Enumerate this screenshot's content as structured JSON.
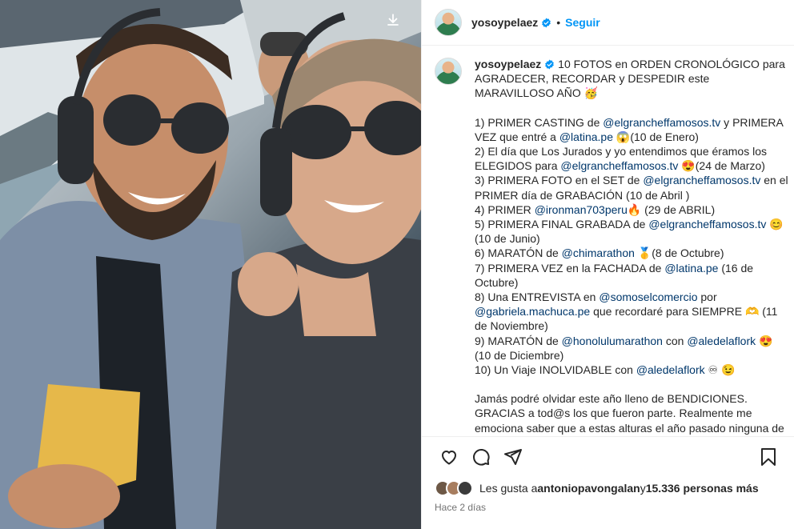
{
  "photo": {
    "alt_subject": "selfie-in-helicopter",
    "download_icon": "download-icon"
  },
  "header": {
    "username": "yosoypelaez",
    "verified_icon": "verified-badge-icon",
    "separator": "•",
    "follow_label": "Seguir"
  },
  "caption": {
    "username": "yosoypelaez",
    "intro": " 10 FOTOS en ORDEN CRONOLÓGICO para AGRADECER, RECORDAR y DESPEDIR este MARAVILLOSO AÑO 🥳",
    "items": [
      "1) PRIMER CASTING de @elgrancheffamosos.tv y PRIMERA VEZ que entré a @latina.pe 😱(10 de Enero)",
      "2) El día que Los Jurados y yo entendimos que éramos los ELEGIDOS para @elgrancheffamosos.tv 😍(24 de Marzo)",
      "3) PRIMERA FOTO en el SET de @elgrancheffamosos.tv en el PRIMER día de GRABACIÓN (10 de Abril )",
      "4) PRIMER @ironman703peru🔥 (29 de ABRIL)",
      "5) PRIMERA FINAL GRABADA de @elgrancheffamosos.tv 😊(10 de Junio)",
      "6) MARATÓN de @chimarathon 🥇(8 de Octubre)",
      "7) PRIMERA VEZ en la FACHADA de @latina.pe (16 de Octubre)",
      "8) Una ENTREVISTA en @somoselcomercio por @gabriela.machuca.pe que recordaré para SIEMPRE 🫶 (11 de Noviembre)",
      "9) MARATÓN de @honolulumarathon con @aledelaflork 😍 (10 de Diciembre)",
      "10) Un Viaje INOLVIDABLE con @aledelaflork ♾ 😉"
    ],
    "outro": "Jamás podré olvidar este año lleno de BENDICIONES. GRACIAS a tod@s los que fueron parte. Realmente me emociona saber que a estas alturas el año pasado ninguna de estas cosas estaban en"
  },
  "actions": {
    "like_icon": "heart-icon",
    "comment_icon": "comment-icon",
    "share_icon": "share-icon",
    "save_icon": "bookmark-icon"
  },
  "likes": {
    "prefix": "Les gusta a ",
    "first_user": "antoniopavongalan",
    "middle": " y ",
    "count_text": "15.336 personas más"
  },
  "timestamp": "Hace 2 días",
  "colors": {
    "link": "#0095f6",
    "verified": "#0095f6",
    "text": "#262626",
    "muted": "#737373",
    "border": "#efefef"
  }
}
